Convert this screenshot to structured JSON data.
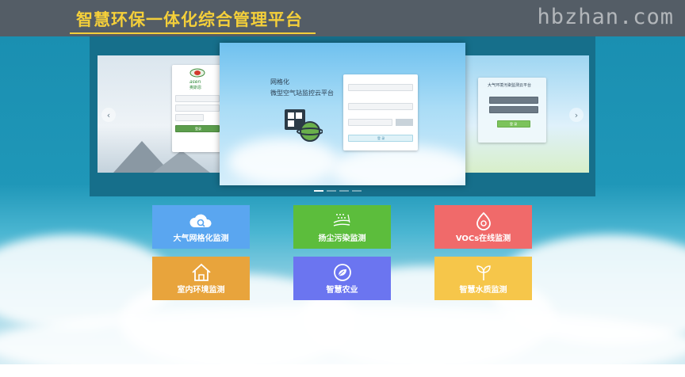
{
  "header": {
    "title": "智慧环保一体化综合管理平台",
    "watermark": "hbzhan.com"
  },
  "carousel": {
    "left_slide": {
      "brand": "asen",
      "brand_cn": "奥斯恩",
      "login_label": "登录"
    },
    "center_slide": {
      "heading_line1": "网格化",
      "heading_line2": "微型空气站监控云平台",
      "login_label": "登 录"
    },
    "right_slide": {
      "heading": "大气环境污染监测云平台",
      "login_label": "登 录"
    },
    "prev_arrow": "‹",
    "next_arrow": "›"
  },
  "tiles": [
    {
      "label": "大气网格化监测",
      "color": "#5aa6f0",
      "icon": "cloud-search-icon"
    },
    {
      "label": "扬尘污染监测",
      "color": "#5cbd3c",
      "icon": "dust-icon"
    },
    {
      "label": "VOCs在线监测",
      "color": "#f06a6a",
      "icon": "voc-drop-icon"
    },
    {
      "label": "室内环境监测",
      "color": "#e8a43c",
      "icon": "house-icon"
    },
    {
      "label": "智慧农业",
      "color": "#6b75f0",
      "icon": "leaf-icon"
    },
    {
      "label": "智慧水质监测",
      "color": "#f6c64a",
      "icon": "water-sprout-icon"
    }
  ]
}
